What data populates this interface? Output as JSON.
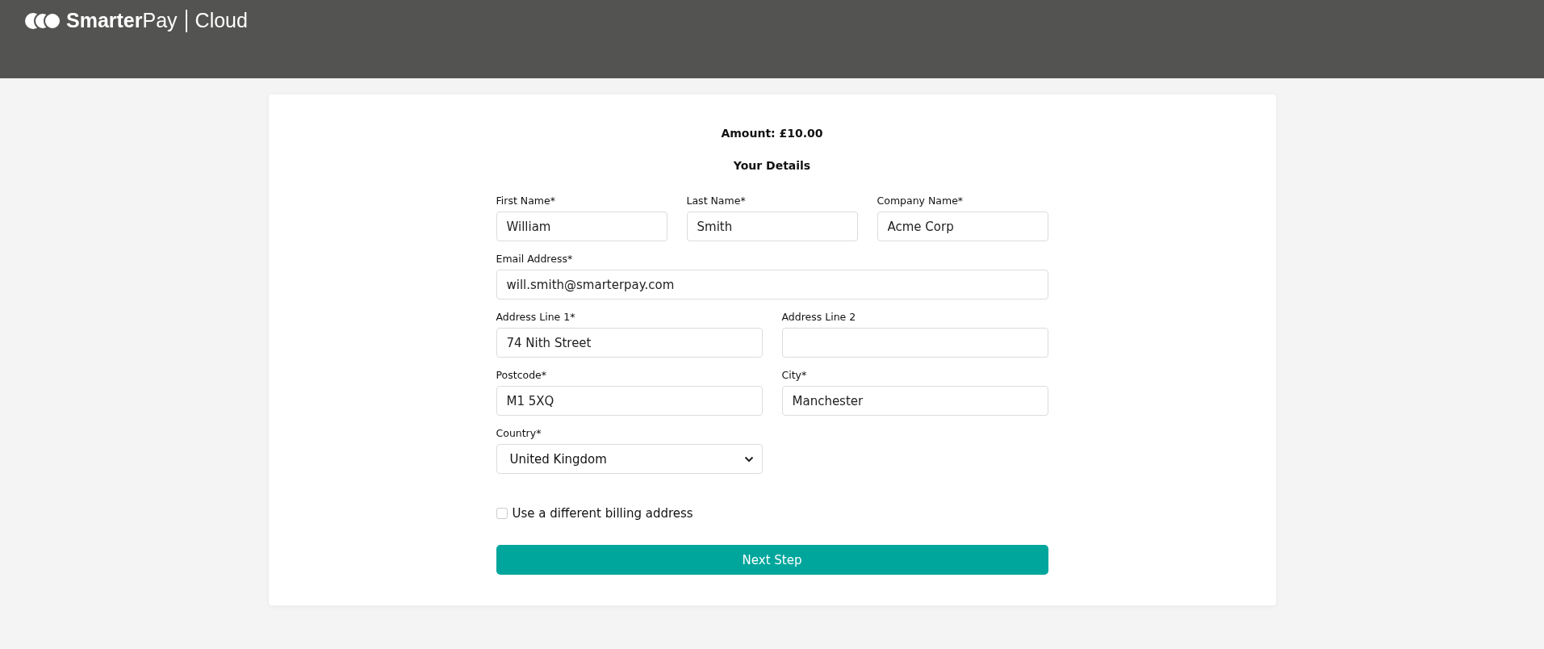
{
  "header": {
    "logo_text": "**Smarter**Pay",
    "product": "Cloud"
  },
  "amount": "Amount: £10.00",
  "heading": "Your Details",
  "rows": [
    {
      "fields": [
        {
          "kind": "text",
          "label": "First Name*",
          "value": "William"
        },
        {
          "kind": "text",
          "label": "Last Name*",
          "value": "Smith"
        },
        {
          "kind": "text",
          "label": "Company Name*",
          "value": "Acme Corp"
        }
      ]
    },
    {
      "fields": [
        {
          "kind": "text",
          "label": "Email Address*",
          "value": "will.smith@smarterpay.com"
        }
      ]
    },
    {
      "fields": [
        {
          "kind": "text",
          "label": "Address Line 1*",
          "value": "74 Nith Street"
        },
        {
          "kind": "text",
          "label": "Address Line 2"
        }
      ]
    },
    {
      "fields": [
        {
          "kind": "text",
          "label": "Postcode*",
          "value": "M1 5XQ"
        },
        {
          "kind": "text",
          "label": "City*",
          "value": "Manchester"
        }
      ]
    },
    {
      "fields": [
        {
          "kind": "select",
          "label": "Country*",
          "value": "United Kingdom"
        }
      ]
    }
  ],
  "billing_checkbox": {
    "label": "Use a different billing address",
    "checked": false
  },
  "button": "Next Step"
}
